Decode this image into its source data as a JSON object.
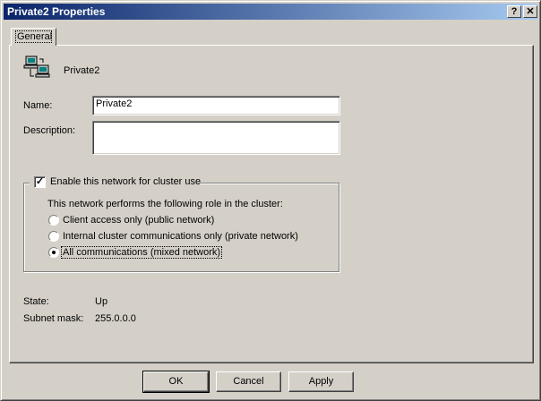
{
  "window": {
    "title": "Private2 Properties",
    "help_glyph": "?",
    "close_glyph": "✕"
  },
  "tabs": [
    {
      "label": "General"
    }
  ],
  "network": {
    "icon": "network-computers-icon",
    "name_display": "Private2",
    "name_label": "Name:",
    "name_value": "Private2",
    "description_label": "Description:",
    "description_value": ""
  },
  "cluster_use": {
    "checkbox_label": "Enable this network for cluster use",
    "checked": true,
    "role_prompt": "This network performs the following role in the cluster:",
    "options": [
      {
        "label": "Client access only (public network)",
        "selected": false
      },
      {
        "label": "Internal cluster communications only (private network)",
        "selected": false
      },
      {
        "label": "All communications (mixed network)",
        "selected": true
      }
    ]
  },
  "status": {
    "state_label": "State:",
    "state_value": "Up",
    "subnet_label": "Subnet mask:",
    "subnet_value": "255.0.0.0"
  },
  "buttons": {
    "ok": "OK",
    "cancel": "Cancel",
    "apply": "Apply"
  }
}
